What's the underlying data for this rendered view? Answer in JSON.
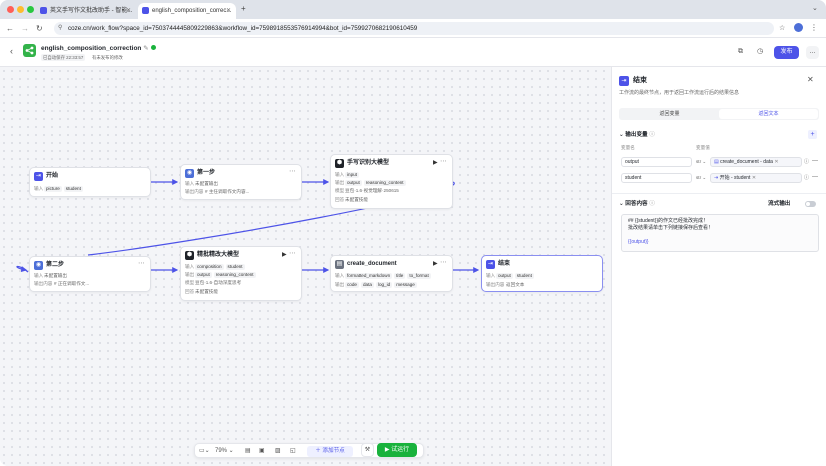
{
  "browser": {
    "tabs": [
      {
        "label": "英文手写作文批改助手 - 智能..."
      },
      {
        "label": "english_composition_correc..."
      }
    ],
    "new_tab": "+",
    "url": "coze.cn/work_flow?space_id=7503744445809229863&workflow_id=7598918553576914994&bot_id=7599270682190610459"
  },
  "header": {
    "workflow_name": "english_composition_correction",
    "autosave": "已自动保存 22:33:57",
    "unpublished": "有未发布的修改",
    "publish": "发布",
    "more": "..."
  },
  "nodes": {
    "start": {
      "title": "开始",
      "row1_key": "输入",
      "row1_chips": [
        "picture",
        "student"
      ]
    },
    "step1": {
      "title": "第一步",
      "row1_key": "输入",
      "row1_val": "未配置输出",
      "row2_key": "输出内容",
      "row2_val": "# 主任调取作文内容..."
    },
    "ocr": {
      "title": "手写识别大模型",
      "r1_key": "输入",
      "r1_chips": [
        "input"
      ],
      "r2_key": "输出",
      "r2_chips": [
        "output",
        "reasoning_content"
      ],
      "r3_key": "模型",
      "r3_val": "豆包·1.6·视觉理解·250615",
      "r4_key": "回答",
      "r4_val": "未配置技能"
    },
    "step2": {
      "title": "第二步",
      "row1_key": "输入",
      "row1_val": "未配置输出",
      "row2_key": "输出内容",
      "row2_val": "# 正在调取作文..."
    },
    "refine": {
      "title": "精批精改大模型",
      "r1_key": "输入",
      "r1_chips": [
        "composition",
        "student"
      ],
      "r2_key": "输出",
      "r2_chips": [
        "output",
        "reasoning_content"
      ],
      "r3_key": "模型",
      "r3_val": "豆包·1.6·自动深度思考",
      "r4_key": "回答",
      "r4_val": "未配置技能"
    },
    "createdoc": {
      "title": "create_document",
      "r1_key": "输入",
      "r1_chips": [
        "formatted_markdown",
        "title",
        "to_format"
      ],
      "r2_key": "输出",
      "r2_chips": [
        "code",
        "data",
        "log_id",
        "message"
      ]
    },
    "end": {
      "title": "结束",
      "r1_key": "输入",
      "r1_chips": [
        "output",
        "student"
      ],
      "r2_key": "输出内容",
      "r2_val": "返回文本"
    }
  },
  "toolbar": {
    "zoom": "79%",
    "add_node": "添加节点",
    "run": "试运行"
  },
  "panel": {
    "title": "结束",
    "subtitle": "工作流的最终节点，用于返回工作流运行后的结果信息",
    "tabs": [
      "返回变量",
      "返回文本"
    ],
    "active_tab": 1,
    "output_section": "输出变量",
    "col_name": "变量名",
    "col_value": "变量值",
    "vars": [
      {
        "name": "output",
        "type": "str",
        "ref": "create_document - data"
      },
      {
        "name": "student",
        "type": "str",
        "ref": "开始 - student"
      }
    ],
    "answer_section": "回答内容",
    "stream_label": "流式输出",
    "answer_lines": [
      "## {{student}}的作文已经批改完成！",
      "批改结果请单击下列链接保存后查看！",
      "",
      "{{output}}"
    ]
  },
  "colors": {
    "accent": "#4d53e8",
    "run": "#19b23c",
    "brand": "#33b34a"
  }
}
